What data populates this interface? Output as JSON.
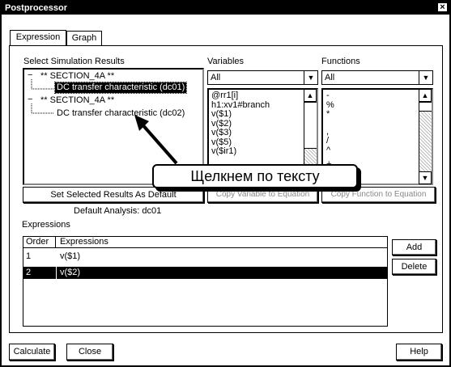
{
  "window": {
    "title": "Postprocessor",
    "close_label": "×"
  },
  "tabs": [
    {
      "label": "Expression"
    },
    {
      "label": "Graph"
    }
  ],
  "results": {
    "label": "Select Simulation Results",
    "tree": [
      {
        "expander": "−",
        "text": "** SECTION_4A **"
      },
      {
        "text": "DC transfer characteristic (dc01)",
        "selected": true
      },
      {
        "expander": "−",
        "text": "** SECTION_4A **"
      },
      {
        "text": "DC transfer characteristic (dc02)"
      }
    ],
    "set_button": "Set Selected Results As Default",
    "default_analysis": "Default Analysis: dc01"
  },
  "variables": {
    "label": "Variables",
    "filter": "All",
    "items": [
      "@rr1[i]",
      "h1:xv1#branch",
      "v($1)",
      "v($2)",
      "v($3)",
      "v($5)",
      "v($ir1)"
    ],
    "copy_button": "Copy Variable to Equation"
  },
  "functions": {
    "label": "Functions",
    "filter": "All",
    "items": [
      "-",
      "%",
      "*",
      ",",
      "/",
      "^",
      "+"
    ],
    "copy_button": "Copy Function to Equation"
  },
  "expressions": {
    "label": "Expressions",
    "columns": [
      "Order",
      "Expressions"
    ],
    "rows": [
      {
        "order": "1",
        "expr": "v($1)",
        "selected": false
      },
      {
        "order": "2",
        "expr": "v($2)",
        "selected": true
      }
    ],
    "add_button": "Add",
    "delete_button": "Delete"
  },
  "footer": {
    "calculate": "Calculate",
    "close": "Close",
    "help": "Help"
  },
  "callout": {
    "text": "Щелкнем по тексту"
  }
}
